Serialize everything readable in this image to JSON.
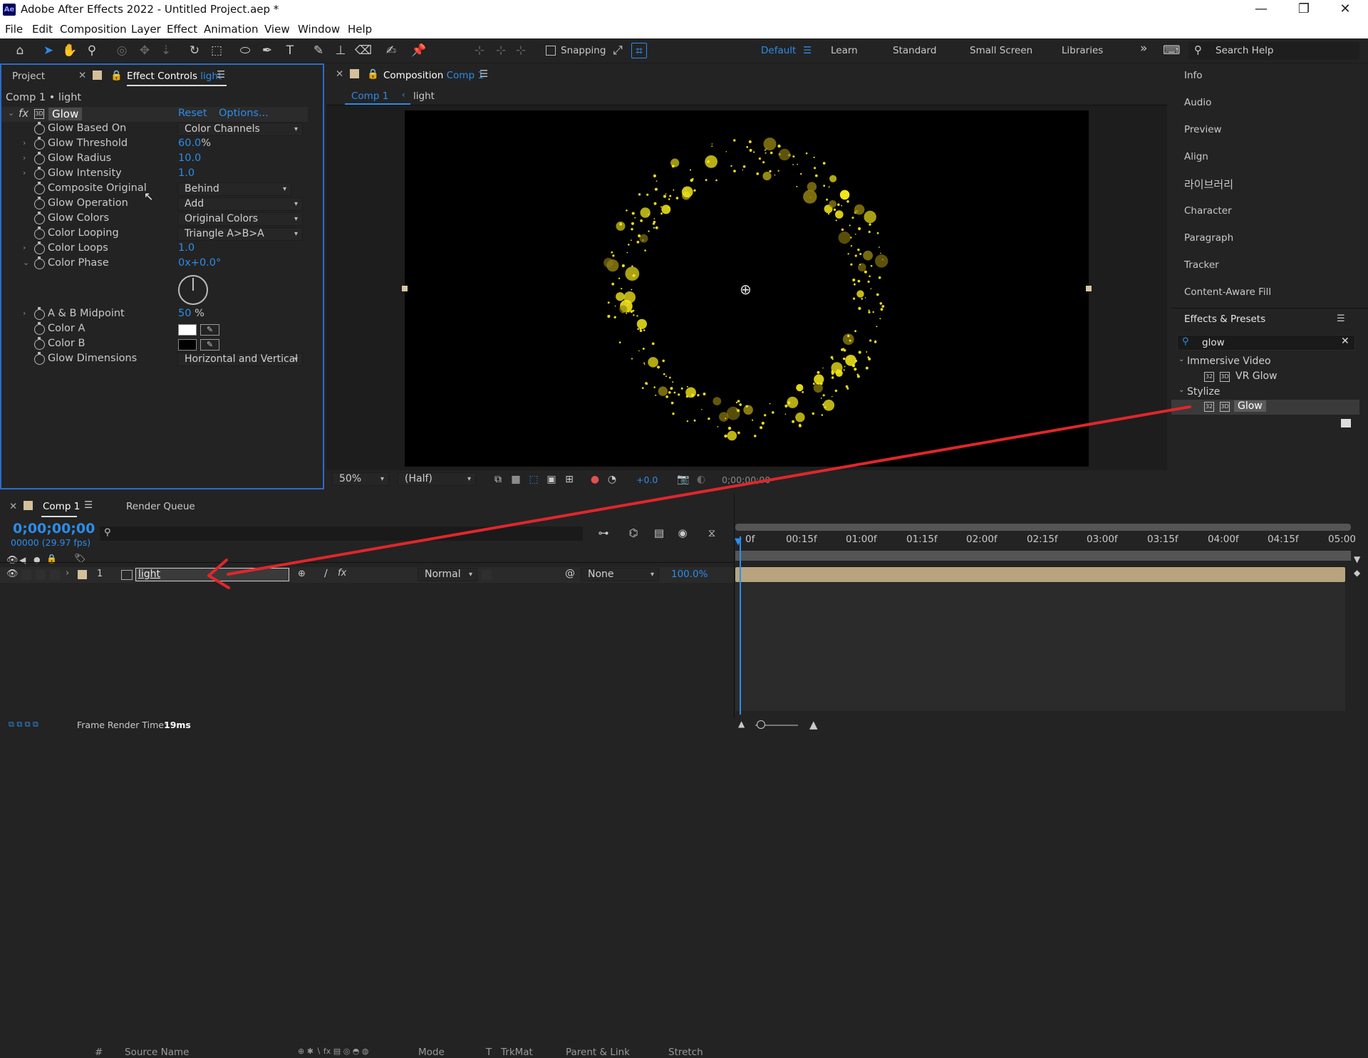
{
  "window": {
    "title": "Adobe After Effects 2022 - Untitled Project.aep *",
    "app_icon": "Ae",
    "minimize": "—",
    "restore": "❐",
    "close": "✕"
  },
  "menu": [
    "File",
    "Edit",
    "Composition",
    "Layer",
    "Effect",
    "Animation",
    "View",
    "Window",
    "Help"
  ],
  "toolbar": {
    "snapping": "Snapping",
    "workspaces": [
      "Default",
      "Learn",
      "Standard",
      "Small Screen",
      "Libraries"
    ],
    "more": "»",
    "search_placeholder": "Search Help"
  },
  "left_panel": {
    "tab_project": "Project",
    "tab_effect_controls": "Effect Controls",
    "tab_effect_layer": "light",
    "breadcrumb": "Comp 1 • light",
    "effect": {
      "name": "Glow",
      "reset": "Reset",
      "options": "Options..."
    },
    "properties": [
      {
        "name": "Glow Based On",
        "type": "dropdown",
        "value": "Color Channels"
      },
      {
        "name": "Glow Threshold",
        "type": "value",
        "value": "60.0",
        "unit": "%"
      },
      {
        "name": "Glow Radius",
        "type": "value",
        "value": "10.0"
      },
      {
        "name": "Glow Intensity",
        "type": "value",
        "value": "1.0"
      },
      {
        "name": "Composite Original",
        "type": "dropdown",
        "value": "Behind"
      },
      {
        "name": "Glow Operation",
        "type": "dropdown",
        "value": "Add"
      },
      {
        "name": "Glow Colors",
        "type": "dropdown",
        "value": "Original Colors"
      },
      {
        "name": "Color Looping",
        "type": "dropdown",
        "value": "Triangle A>B>A"
      },
      {
        "name": "Color Loops",
        "type": "value",
        "value": "1.0"
      },
      {
        "name": "Color Phase",
        "type": "angle",
        "value": "0x+0.0°"
      },
      {
        "name": "A & B Midpoint",
        "type": "value",
        "value": "50",
        "unit": "%"
      },
      {
        "name": "Color A",
        "type": "color",
        "value": "#ffffff"
      },
      {
        "name": "Color B",
        "type": "color",
        "value": "#000000"
      },
      {
        "name": "Glow Dimensions",
        "type": "dropdown",
        "value": "Horizontal and Vertical"
      }
    ]
  },
  "comp_panel": {
    "tab_label": "Composition",
    "tab_comp": "Comp 1",
    "subtab_comp": "Comp 1",
    "subtab_layer": "light",
    "zoom": "50%",
    "resolution": "(Half)",
    "exposure": "+0.0",
    "timecode": "0;00;00;00"
  },
  "right_panel": {
    "items": [
      "Info",
      "Audio",
      "Preview",
      "Align",
      "라이브러리",
      "Character",
      "Paragraph",
      "Tracker",
      "Content-Aware Fill"
    ],
    "effects_presets": {
      "title": "Effects & Presets",
      "search_value": "glow",
      "groups": [
        {
          "name": "Immersive Video",
          "items": [
            "VR Glow"
          ]
        },
        {
          "name": "Stylize",
          "items": [
            "Glow"
          ]
        }
      ]
    }
  },
  "timeline": {
    "tab_comp": "Comp 1",
    "tab_render": "Render Queue",
    "timecode": "0;00;00;00",
    "fps_info": "00000 (29.97 fps)",
    "columns": {
      "num": "#",
      "source": "Source Name",
      "mode": "Mode",
      "t": "T",
      "trkmat": "TrkMat",
      "parent": "Parent & Link",
      "stretch": "Stretch"
    },
    "ruler": [
      "0f",
      "00:15f",
      "01:00f",
      "01:15f",
      "02:00f",
      "02:15f",
      "03:00f",
      "03:15f",
      "04:00f",
      "04:15f",
      "05:00"
    ],
    "layers": [
      {
        "num": "1",
        "name": "light",
        "mode": "Normal",
        "parent": "None",
        "stretch": "100.0%"
      }
    ]
  },
  "status": {
    "label": "Frame Render Time:",
    "value": "19ms"
  },
  "colors": {
    "accent": "#2d8ceb",
    "arrow": "#e0262c",
    "layer_bar": "#b7a47f",
    "label": "#d4c09a"
  }
}
